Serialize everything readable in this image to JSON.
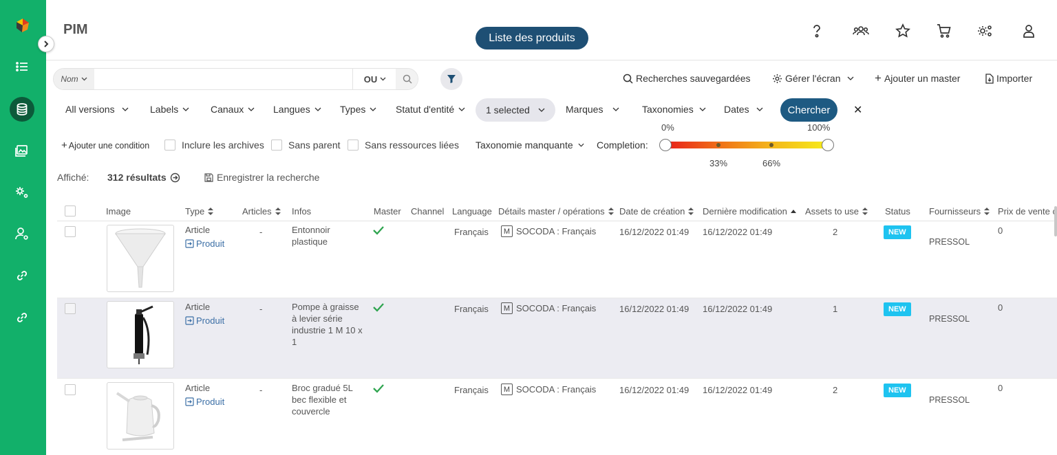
{
  "app": {
    "title": "PIM",
    "page_title": "Liste des produits"
  },
  "search": {
    "field_label": "Nom",
    "value": "",
    "operator": "OU"
  },
  "actions": {
    "saved_searches": "Recherches sauvegardées",
    "manage_screen": "Gérer l'écran",
    "add_master": "Ajouter un master",
    "import": "Importer"
  },
  "filters": {
    "all_versions": "All versions",
    "labels": "Labels",
    "channels": "Canaux",
    "languages": "Langues",
    "types": "Types",
    "entity_status": "Statut d'entité",
    "selected": "1 selected",
    "brands": "Marques",
    "taxonomies": "Taxonomies",
    "dates": "Dates",
    "search_button": "Chercher"
  },
  "conditions": {
    "add_condition": "Ajouter une condition",
    "include_archives": "Inclure les archives",
    "no_parent": "Sans parent",
    "no_linked_resources": "Sans ressources liées",
    "missing_taxonomy": "Taxonomie manquante",
    "completion_label": "Completion:",
    "completion_min": "0%",
    "completion_max": "100%",
    "completion_mark_1": "33%",
    "completion_mark_2": "66%",
    "completion_range": [
      0,
      100
    ]
  },
  "summary": {
    "shown_label": "Affiché:",
    "results": "312 résultats",
    "save_search": "Enregistrer la recherche"
  },
  "table": {
    "headers": {
      "image": "Image",
      "type": "Type",
      "articles": "Articles",
      "infos": "Infos",
      "master": "Master",
      "channel": "Channel",
      "language": "Language",
      "master_details": "Détails master / opérations",
      "created": "Date de création",
      "modified": "Dernière modification",
      "assets": "Assets to use",
      "status": "Status",
      "suppliers": "Fournisseurs",
      "price": "Prix de vente c"
    },
    "rows": [
      {
        "type": "Article",
        "link": "Produit",
        "articles": "-",
        "infos": "Entonnoir plastique",
        "language": "Français",
        "master_tag": "M",
        "master_details": "SOCODA : Français",
        "created": "16/12/2022 01:49",
        "modified": "16/12/2022 01:49",
        "assets": "2",
        "status": "NEW",
        "supplier": "PRESSOL",
        "price": "0",
        "image_icon": "funnel-image"
      },
      {
        "type": "Article",
        "link": "Produit",
        "articles": "-",
        "infos": "Pompe à graisse à levier série industrie 1 M 10 x 1",
        "language": "Français",
        "master_tag": "M",
        "master_details": "SOCODA : Français",
        "created": "16/12/2022 01:49",
        "modified": "16/12/2022 01:49",
        "assets": "1",
        "status": "NEW",
        "supplier": "PRESSOL",
        "price": "0",
        "image_icon": "grease-gun-image"
      },
      {
        "type": "Article",
        "link": "Produit",
        "articles": "-",
        "infos": "Broc gradué 5L bec flexible et couvercle",
        "language": "Français",
        "master_tag": "M",
        "master_details": "SOCODA : Français",
        "created": "16/12/2022 01:49",
        "modified": "16/12/2022 01:49",
        "assets": "2",
        "status": "NEW",
        "supplier": "PRESSOL",
        "price": "0",
        "image_icon": "jug-image"
      }
    ]
  },
  "colors": {
    "sidebar": "#12b06a",
    "primary": "#1e4f74",
    "status_new": "#1ec3f0",
    "check": "#2ea44f"
  }
}
